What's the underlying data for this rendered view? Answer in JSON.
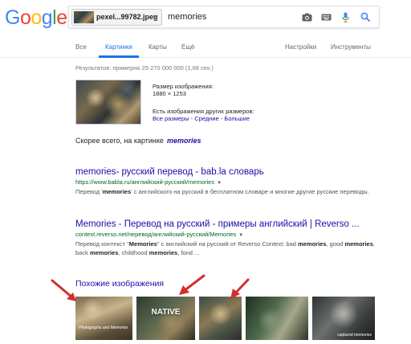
{
  "logo": {
    "letters": [
      "G",
      "o",
      "o",
      "g",
      "l",
      "e"
    ],
    "colors": [
      "#4285F4",
      "#EA4335",
      "#FBBC05",
      "#4285F4",
      "#34A853",
      "#EA4335"
    ]
  },
  "search": {
    "chip_filename": "pexel...99782.jpeg",
    "chip_close": "×",
    "query": "memories",
    "icons": [
      "camera-icon",
      "keyboard-icon",
      "microphone-icon",
      "search-icon"
    ]
  },
  "tabs": {
    "items": [
      {
        "label": "Все",
        "active": false
      },
      {
        "label": "Картинки",
        "active": true
      },
      {
        "label": "Карты",
        "active": false
      },
      {
        "label": "Ещё",
        "active": false
      }
    ],
    "settings": "Настройки",
    "tools": "Инструменты"
  },
  "stats": "Результатов: примерно 25 270 000 000 (1,68 сек.)",
  "image_info": {
    "size_label": "Размер изображения:",
    "size_value": "1880 × 1253",
    "other_sizes": "Есть изображения других размеров:",
    "links": [
      "Все размеры",
      "Средние",
      "Большие"
    ],
    "sep": " - "
  },
  "best_guess": {
    "prefix": "Скорее всего, на картинке",
    "term": "memories"
  },
  "results": [
    {
      "title": "memories- русский перевод - bab.la словарь",
      "url": "https://www.babla.ru/английский-русский/memories",
      "snippet_parts": [
        {
          "t": "Перевод '",
          "b": false
        },
        {
          "t": "memories",
          "b": true
        },
        {
          "t": "' с английского на русский в бесплатном словаре и многие другие русские переводы.",
          "b": false
        }
      ]
    },
    {
      "title": "Memories - Перевод на русский - примеры английский | Reverso ...",
      "url": "context.reverso.net/перевод/английский-русский/Memories",
      "snippet_parts": [
        {
          "t": "Перевод контекст \"",
          "b": false
        },
        {
          "t": "Memories",
          "b": true
        },
        {
          "t": "\" с английский на русский от Reverso Context: bad ",
          "b": false
        },
        {
          "t": "memories",
          "b": true
        },
        {
          "t": ", good ",
          "b": false
        },
        {
          "t": "memories",
          "b": true
        },
        {
          "t": ", back ",
          "b": false
        },
        {
          "t": "memories",
          "b": true
        },
        {
          "t": ", childhood ",
          "b": false
        },
        {
          "t": "memories",
          "b": true
        },
        {
          "t": ", fond ...",
          "b": false
        }
      ]
    }
  ],
  "similar": {
    "heading": "Похожие изображения",
    "images": [
      {
        "overlay": "Photographs and Memories"
      },
      {
        "overlay": "NATIVE"
      },
      {
        "overlay": ""
      },
      {
        "overlay": ""
      },
      {
        "overlay": "captured memories"
      }
    ]
  },
  "accent": "#1a73e8",
  "arrow_color": "#d32f2f"
}
